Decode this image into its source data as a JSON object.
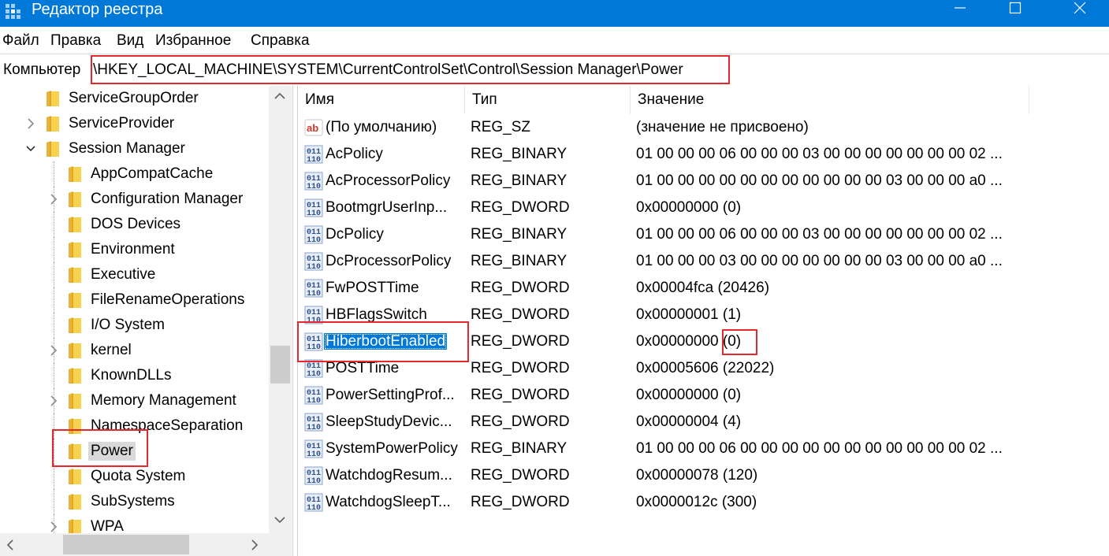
{
  "window": {
    "title": "Редактор реестра",
    "icon": "registry-editor-icon",
    "accent": "#0078d7"
  },
  "menu": [
    "Файл",
    "Правка",
    "Вид",
    "Избранное",
    "Справка"
  ],
  "address": {
    "root": "Компьютер",
    "path": "\\HKEY_LOCAL_MACHINE\\SYSTEM\\CurrentControlSet\\Control\\Session Manager\\Power"
  },
  "tree": {
    "items": [
      {
        "label": "ServiceGroupOrder",
        "level": 1,
        "expander": "none",
        "selected": false
      },
      {
        "label": "ServiceProvider",
        "level": 1,
        "expander": "collapsed",
        "selected": false
      },
      {
        "label": "Session Manager",
        "level": 1,
        "expander": "expanded",
        "selected": false
      },
      {
        "label": "AppCompatCache",
        "level": 2,
        "expander": "none",
        "selected": false
      },
      {
        "label": "Configuration Manager",
        "level": 2,
        "expander": "collapsed",
        "selected": false
      },
      {
        "label": "DOS Devices",
        "level": 2,
        "expander": "none",
        "selected": false
      },
      {
        "label": "Environment",
        "level": 2,
        "expander": "none",
        "selected": false
      },
      {
        "label": "Executive",
        "level": 2,
        "expander": "none",
        "selected": false
      },
      {
        "label": "FileRenameOperations",
        "level": 2,
        "expander": "none",
        "selected": false
      },
      {
        "label": "I/O System",
        "level": 2,
        "expander": "none",
        "selected": false
      },
      {
        "label": "kernel",
        "level": 2,
        "expander": "collapsed",
        "selected": false
      },
      {
        "label": "KnownDLLs",
        "level": 2,
        "expander": "none",
        "selected": false
      },
      {
        "label": "Memory Management",
        "level": 2,
        "expander": "collapsed",
        "selected": false
      },
      {
        "label": "NamespaceSeparation",
        "level": 2,
        "expander": "none",
        "selected": false
      },
      {
        "label": "Power",
        "level": 2,
        "expander": "none",
        "selected": true
      },
      {
        "label": "Quota System",
        "level": 2,
        "expander": "none",
        "selected": false
      },
      {
        "label": "SubSystems",
        "level": 2,
        "expander": "none",
        "selected": false
      },
      {
        "label": "WPA",
        "level": 2,
        "expander": "collapsed",
        "selected": false
      }
    ]
  },
  "list": {
    "columns": [
      "Имя",
      "Тип",
      "Значение"
    ],
    "rows": [
      {
        "icon": "string-value-icon",
        "name": "(По умолчанию)",
        "type": "REG_SZ",
        "data": "(значение не присвоено)",
        "selected": false
      },
      {
        "icon": "binary-value-icon",
        "name": "AcPolicy",
        "type": "REG_BINARY",
        "data": "01 00 00 00 06 00 00 00 03 00 00 00 00 00 00 00 02 ...",
        "selected": false
      },
      {
        "icon": "binary-value-icon",
        "name": "AcProcessorPolicy",
        "type": "REG_BINARY",
        "data": "01 00 00 00 00 00 00 00 00 00 00 00 03 00 00 00 a0 ...",
        "selected": false
      },
      {
        "icon": "binary-value-icon",
        "name": "BootmgrUserInp...",
        "type": "REG_DWORD",
        "data": "0x00000000 (0)",
        "selected": false
      },
      {
        "icon": "binary-value-icon",
        "name": "DcPolicy",
        "type": "REG_BINARY",
        "data": "01 00 00 00 06 00 00 00 03 00 00 00 00 00 00 00 02 ...",
        "selected": false
      },
      {
        "icon": "binary-value-icon",
        "name": "DcProcessorPolicy",
        "type": "REG_BINARY",
        "data": "01 00 00 00 03 00 00 00 00 00 00 00 03 00 00 00 a0 ...",
        "selected": false
      },
      {
        "icon": "binary-value-icon",
        "name": "FwPOSTTime",
        "type": "REG_DWORD",
        "data": "0x00004fca (20426)",
        "selected": false
      },
      {
        "icon": "binary-value-icon",
        "name": "HBFlagsSwitch",
        "type": "REG_DWORD",
        "data": "0x00000001 (1)",
        "selected": false
      },
      {
        "icon": "binary-value-icon",
        "name": "HiberbootEnabled",
        "type": "REG_DWORD",
        "data": "0x00000000 (0)",
        "selected": true
      },
      {
        "icon": "binary-value-icon",
        "name": "POSTTime",
        "type": "REG_DWORD",
        "data": "0x00005606 (22022)",
        "selected": false
      },
      {
        "icon": "binary-value-icon",
        "name": "PowerSettingProf...",
        "type": "REG_DWORD",
        "data": "0x00000000 (0)",
        "selected": false
      },
      {
        "icon": "binary-value-icon",
        "name": "SleepStudyDevic...",
        "type": "REG_DWORD",
        "data": "0x00000004 (4)",
        "selected": false
      },
      {
        "icon": "binary-value-icon",
        "name": "SystemPowerPolicy",
        "type": "REG_BINARY",
        "data": "01 00 00 00 06 00 00 00 00 00 00 00 00 00 00 00 02 ...",
        "selected": false
      },
      {
        "icon": "binary-value-icon",
        "name": "WatchdogResum...",
        "type": "REG_DWORD",
        "data": "0x00000078 (120)",
        "selected": false
      },
      {
        "icon": "binary-value-icon",
        "name": "WatchdogSleepT...",
        "type": "REG_DWORD",
        "data": "0x0000012c (300)",
        "selected": false
      }
    ]
  },
  "annotations": {
    "highlight_color": "#e5282e"
  }
}
